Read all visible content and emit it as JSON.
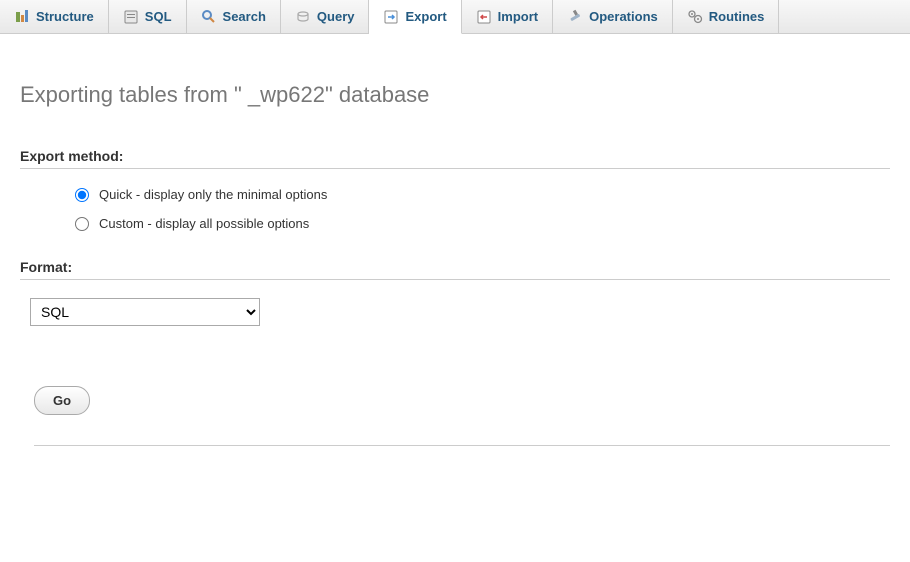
{
  "tabs": [
    {
      "label": "Structure",
      "icon": "structure-icon"
    },
    {
      "label": "SQL",
      "icon": "sql-icon"
    },
    {
      "label": "Search",
      "icon": "search-icon"
    },
    {
      "label": "Query",
      "icon": "query-icon"
    },
    {
      "label": "Export",
      "icon": "export-icon",
      "active": true
    },
    {
      "label": "Import",
      "icon": "import-icon"
    },
    {
      "label": "Operations",
      "icon": "operations-icon"
    },
    {
      "label": "Routines",
      "icon": "routines-icon"
    }
  ],
  "page_title": "Exporting tables from \"          _wp622\" database",
  "export_method": {
    "legend": "Export method:",
    "options": [
      {
        "label": "Quick - display only the minimal options",
        "checked": true
      },
      {
        "label": "Custom - display all possible options",
        "checked": false
      }
    ]
  },
  "format": {
    "legend": "Format:",
    "selected": "SQL"
  },
  "go_button": "Go"
}
